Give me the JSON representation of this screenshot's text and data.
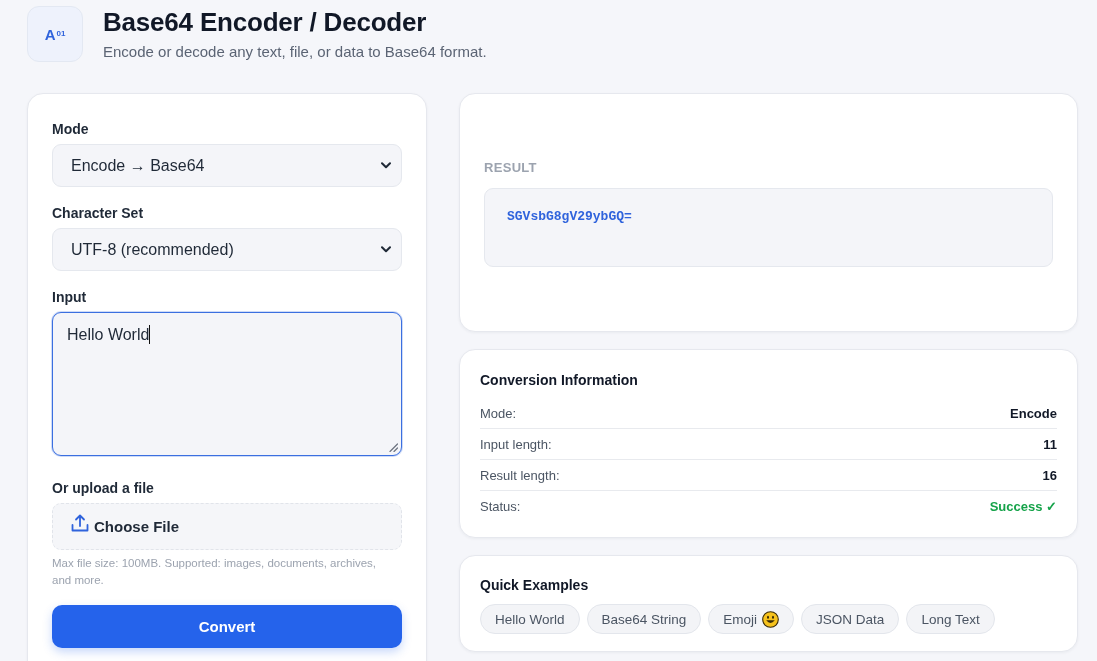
{
  "header": {
    "logo": "A$^{01}$",
    "title": "Base64 Encoder / Decoder",
    "subtitle": "Encode or decode any text, file, or data to Base64 format."
  },
  "form": {
    "fields": [
      {
        "kind": "select",
        "label": "Mode",
        "value": "Encode → Base64"
      },
      {
        "kind": "select",
        "label": "Character Set",
        "value": "UTF-8 (recommended)"
      },
      {
        "kind": "textarea",
        "label": "Input",
        "value": "Hello World",
        "focused": true
      },
      {
        "kind": "file",
        "label": "Or upload a file",
        "button": "Choose File",
        "hint": "Max file size: 100MB. Supported: images, documents, archives, and more."
      }
    ],
    "convert_button": "Convert"
  },
  "result": {
    "label": "RESULT",
    "value": "SGVsbG8gV29ybGQ="
  },
  "info": {
    "title": "Conversion Information",
    "rows": [
      {
        "label": "Mode:",
        "value": "Encode",
        "kind": "plain"
      },
      {
        "label": "Input length:",
        "value": "11",
        "kind": "plain"
      },
      {
        "label": "Result length:",
        "value": "16",
        "kind": "plain"
      },
      {
        "label": "Status:",
        "value": "Success ✓",
        "kind": "success"
      }
    ]
  },
  "examples": {
    "title": "Quick Examples",
    "chips": [
      {
        "label": "Hello World",
        "kind": "plain"
      },
      {
        "label": "Base64 String",
        "kind": "plain"
      },
      {
        "label": "Emoji",
        "kind": "emoji"
      },
      {
        "label": "JSON Data",
        "kind": "plain"
      },
      {
        "label": "Long Text",
        "kind": "plain"
      }
    ]
  }
}
